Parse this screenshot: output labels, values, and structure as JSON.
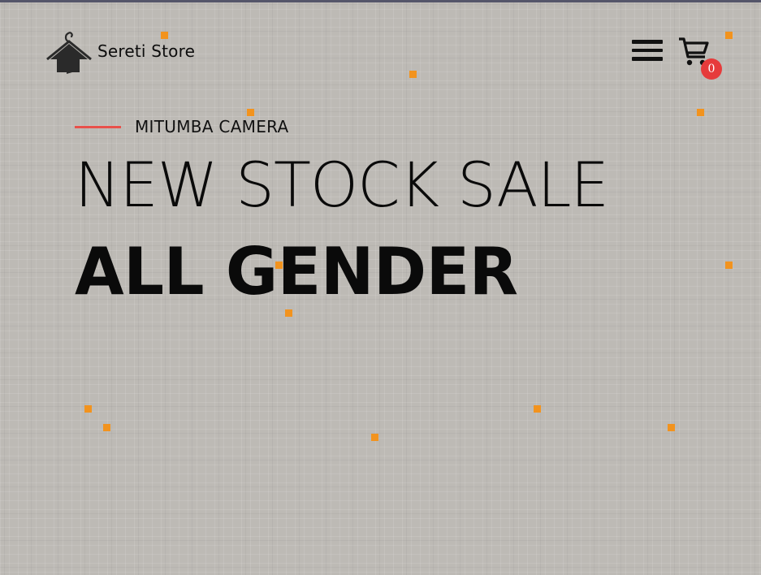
{
  "brand": {
    "name": "Sereti Store",
    "logo_icon": "hanger-house-icon"
  },
  "header": {
    "menu_icon": "hamburger-menu-icon",
    "cart_icon": "shopping-cart-icon",
    "cart_count": "0"
  },
  "hero": {
    "eyebrow": "MITUMBA CAMERA",
    "headline_light": "NEW STOCK SALE",
    "headline_bold": "ALL GENDER"
  },
  "colors": {
    "background": "#bdbab5",
    "accent_line": "#e8514b",
    "badge": "#e63b3b",
    "dot": "#f2931e",
    "text": "#0a0a0a"
  }
}
